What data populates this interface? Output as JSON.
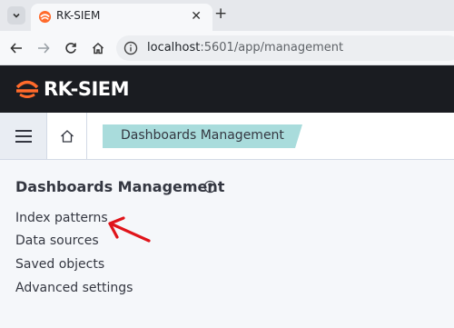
{
  "browser": {
    "tab_title": "RK-SIEM",
    "url_host": "localhost",
    "url_rest": ":5601/app/management",
    "icons": [
      "tab-list-icon",
      "favicon-icon",
      "close-icon",
      "new-tab-icon",
      "back-icon",
      "forward-icon",
      "reload-icon",
      "home-icon",
      "site-info-icon"
    ]
  },
  "app": {
    "brand": "RK-SIEM",
    "brand_color": "#ff6a2b",
    "header_bg": "#1a1c21"
  },
  "breadcrumb": {
    "current": "Dashboards Management",
    "color": "#a9dcdc"
  },
  "management": {
    "title": "Dashboards Management",
    "links": [
      {
        "label": "Index patterns"
      },
      {
        "label": "Data sources"
      },
      {
        "label": "Saved objects"
      },
      {
        "label": "Advanced settings"
      }
    ]
  },
  "annotation": {
    "color": "#e0141a",
    "points_to": "Index patterns"
  }
}
